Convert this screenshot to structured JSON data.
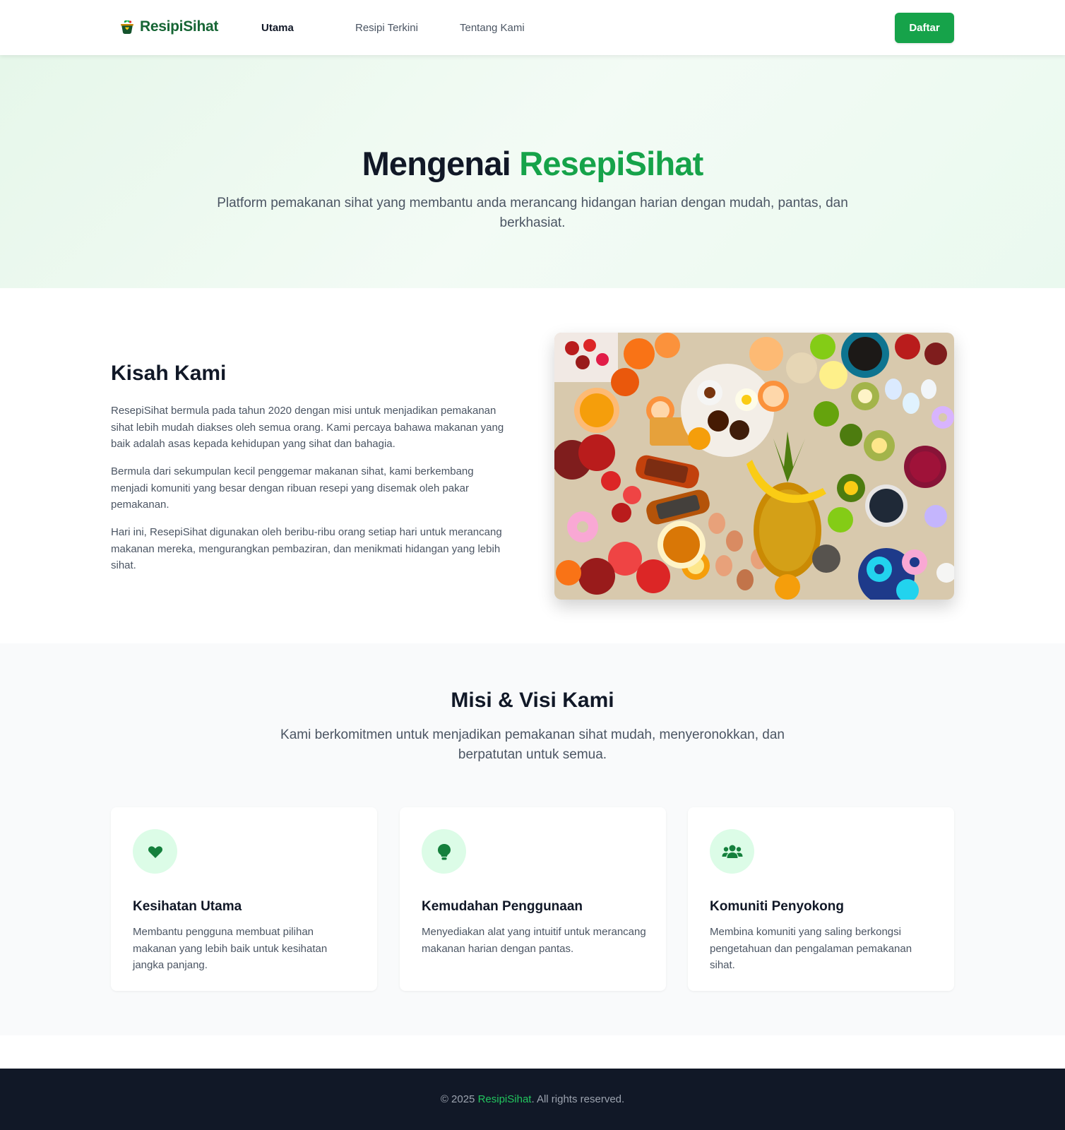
{
  "nav": {
    "brand": "ResipiSihat",
    "links": [
      "Utama",
      "Resipi Terkini",
      "Tentang Kami"
    ],
    "active": "Utama",
    "cta": "Daftar"
  },
  "hero": {
    "title_prefix": "Mengenai",
    "title_accent": "ResepiSihat",
    "subtitle": "Platform pemakanan sihat yang membantu anda merancang hidangan harian dengan mudah, pantas, dan berkhasiat."
  },
  "story": {
    "title": "Kisah Kami",
    "paragraphs": [
      "ResepiSihat bermula pada tahun 2020 dengan misi untuk menjadikan pemakanan sihat lebih mudah diakses oleh semua orang. Kami percaya bahawa makanan yang baik adalah asas kepada kehidupan yang sihat dan bahagia.",
      "Bermula dari sekumpulan kecil penggemar makanan sihat, kami berkembang menjadi komuniti yang besar dengan ribuan resepi yang disemak oleh pakar pemakanan.",
      "Hari ini, ResepiSihat digunakan oleh beribu-ribu orang setiap hari untuk merancang makanan mereka, mengurangkan pembaziran, dan menikmati hidangan yang lebih sihat."
    ]
  },
  "mission": {
    "title": "Misi & Visi Kami",
    "subtitle": "Kami berkomitmen untuk menjadikan pemakanan sihat mudah, menyeronokkan, dan berpatutan untuk semua.",
    "cards": [
      {
        "icon": "heart-icon",
        "title": "Kesihatan Utama",
        "desc": "Membantu pengguna membuat pilihan makanan yang lebih baik untuk kesihatan jangka panjang."
      },
      {
        "icon": "lightbulb-icon",
        "title": "Kemudahan Penggunaan",
        "desc": "Menyediakan alat yang intuitif untuk merancang makanan harian dengan pantas."
      },
      {
        "icon": "users-icon",
        "title": "Komuniti Penyokong",
        "desc": "Membina komuniti yang saling berkongsi pengetahuan dan pengalaman pemakanan sihat."
      }
    ]
  },
  "footer": {
    "prefix": "© 2025",
    "brand": "ResipiSihat",
    "suffix": ". All rights reserved."
  },
  "colors": {
    "accent": "#16a34a",
    "dark_green": "#166534",
    "icon_bg": "#dcfce7",
    "footer_bg": "#111827"
  }
}
